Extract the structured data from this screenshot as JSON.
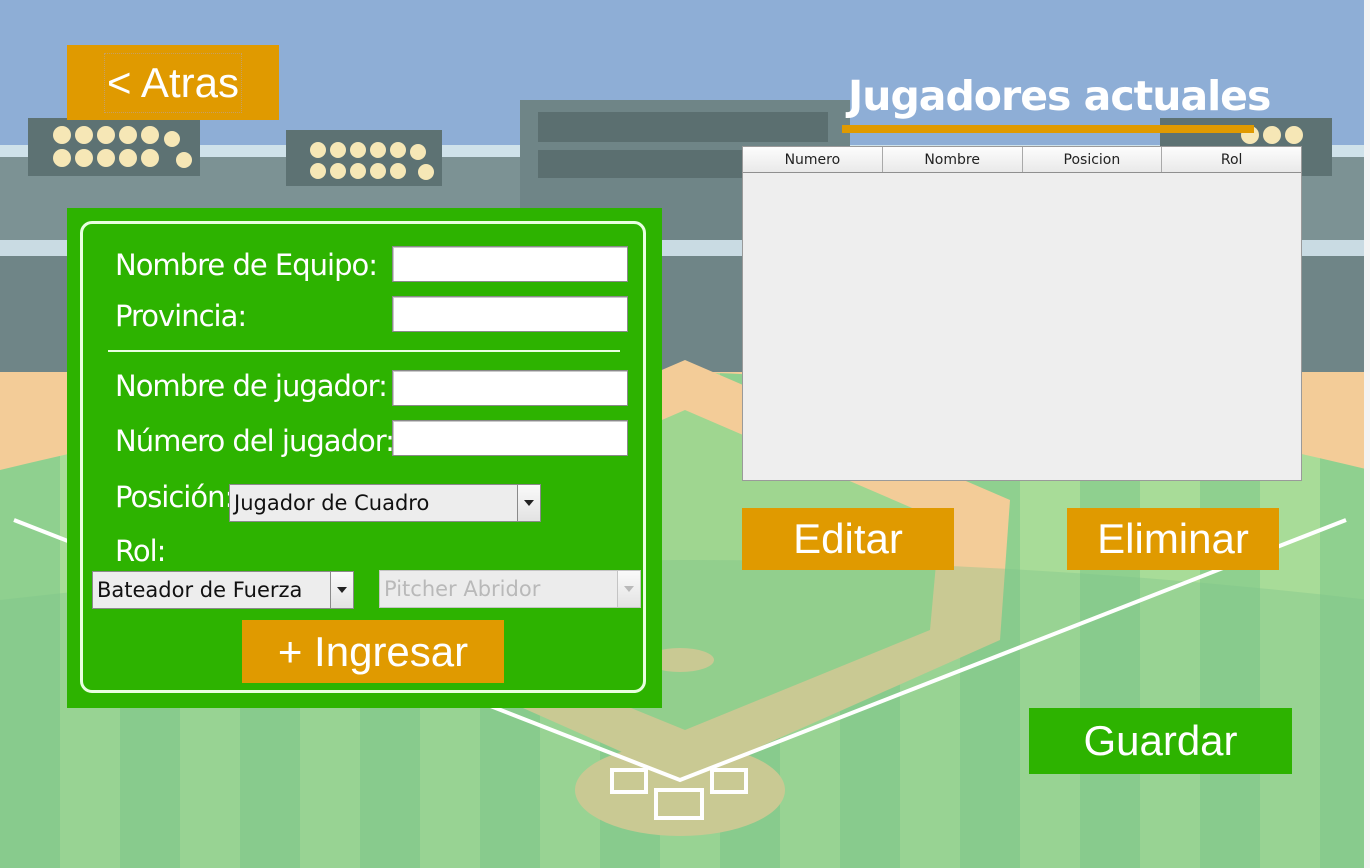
{
  "navigation": {
    "back_label": "< Atras"
  },
  "players_section": {
    "title": "Jugadores actuales",
    "table": {
      "columns": [
        "Numero",
        "Nombre",
        "Posicion",
        "Rol"
      ],
      "rows": []
    },
    "edit_label": "Editar",
    "delete_label": "Eliminar"
  },
  "form": {
    "team_name_label": "Nombre de Equipo:",
    "team_name_value": "",
    "province_label": "Provincia:",
    "province_value": "",
    "player_name_label": "Nombre de jugador:",
    "player_name_value": "",
    "player_number_label": "Número del jugador:",
    "player_number_value": "",
    "position_label": "Posición:",
    "position_selected": "Jugador de Cuadro",
    "role_label": "Rol:",
    "role_selected": "Bateador de Fuerza",
    "pitcher_role_selected": "Pitcher Abridor",
    "add_label": "+ Ingresar"
  },
  "save_label": "Guardar",
  "colors": {
    "accent_orange": "#e09a00",
    "panel_green": "#2db300",
    "sky": "#8eaed6"
  }
}
